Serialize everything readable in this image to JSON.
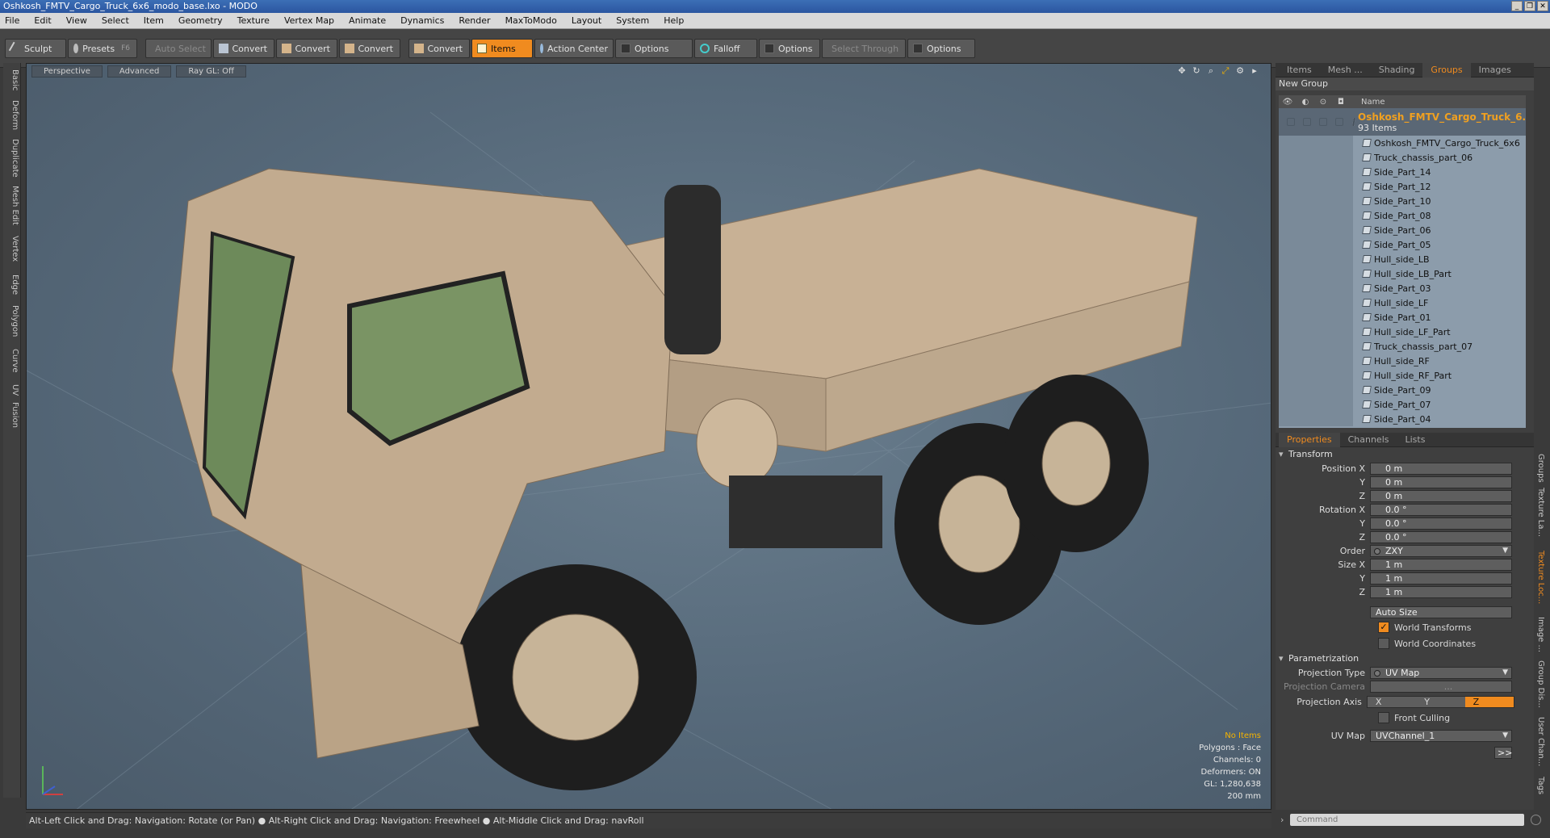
{
  "window": {
    "title": "Oshkosh_FMTV_Cargo_Truck_6x6_modo_base.lxo - MODO"
  },
  "menu": [
    "File",
    "Edit",
    "View",
    "Select",
    "Item",
    "Geometry",
    "Texture",
    "Vertex Map",
    "Animate",
    "Dynamics",
    "Render",
    "MaxToModo",
    "Layout",
    "System",
    "Help"
  ],
  "toolbar": {
    "sculpt": "Sculpt",
    "presets": "Presets",
    "presets_key": "F6",
    "auto_select": "Auto Select",
    "convert1": "Convert",
    "convert2": "Convert",
    "convert3": "Convert",
    "convert4": "Convert",
    "items": "Items",
    "action_center": "Action Center",
    "options1": "Options",
    "falloff": "Falloff",
    "options2": "Options",
    "select_through": "Select Through",
    "options3": "Options"
  },
  "left_tabs": [
    "Basic",
    "Deform",
    "Duplicate",
    "Mesh Edit",
    "Vertex",
    "Edge",
    "Polygon",
    "Curve",
    "UV",
    "Fusion"
  ],
  "viewport": {
    "view": "Perspective",
    "shading": "Advanced",
    "raygl": "Ray GL: Off",
    "stats": {
      "items": "No Items",
      "polygons": "Polygons : Face",
      "channels": "Channels: 0",
      "deformers": "Deformers: ON",
      "gl": "GL: 1,280,638",
      "size": "200 mm"
    }
  },
  "status": "Alt-Left Click and Drag: Navigation: Rotate (or Pan) ● Alt-Right Click and Drag: Navigation: Freewheel ● Alt-Middle Click and Drag: navRoll",
  "panel_tabs": [
    "Items",
    "Mesh ...",
    "Shading",
    "Groups",
    "Images"
  ],
  "new_group": "New Group",
  "tree_header": "Name",
  "group": {
    "name": "Oshkosh_FMTV_Cargo_Truck_6...",
    "count": "93 Items"
  },
  "tree_items": [
    "Oshkosh_FMTV_Cargo_Truck_6x6",
    "Truck_chassis_part_06",
    "Side_Part_14",
    "Side_Part_12",
    "Side_Part_10",
    "Side_Part_08",
    "Side_Part_06",
    "Side_Part_05",
    "Hull_side_LB",
    "Hull_side_LB_Part",
    "Side_Part_03",
    "Hull_side_LF",
    "Side_Part_01",
    "Hull_side_LF_Part",
    "Truck_chassis_part_07",
    "Hull_side_RF",
    "Hull_side_RF_Part",
    "Side_Part_09",
    "Side_Part_07",
    "Side_Part_04"
  ],
  "prop_tabs": [
    "Properties",
    "Channels",
    "Lists"
  ],
  "properties": {
    "transform": "Transform",
    "position_label": "Position X",
    "pos": [
      "0 m",
      "0 m",
      "0 m"
    ],
    "rotation_label": "Rotation X",
    "rot": [
      "0.0 °",
      "0.0 °",
      "0.0 °"
    ],
    "order_label": "Order",
    "order": "ZXY",
    "size_label": "Size X",
    "size": [
      "1 m",
      "1 m",
      "1 m"
    ],
    "y": "Y",
    "z": "Z",
    "auto_size": "Auto Size",
    "world_transforms": "World Transforms",
    "world_coordinates": "World Coordinates",
    "parametrization": "Parametrization",
    "projection_type_label": "Projection Type",
    "projection_type": "UV Map",
    "projection_camera_label": "Projection Camera",
    "projection_camera": "...",
    "projection_axis_label": "Projection Axis",
    "axes": [
      "X",
      "Y",
      "Z"
    ],
    "front_culling": "Front Culling",
    "uvmap_label": "UV Map",
    "uvmap": "UVChannel_1",
    "more": ">>"
  },
  "right_vtabs": [
    "Groups",
    "Texture La...",
    "Texture Loc...",
    "Image ...",
    "Group Dis...",
    "User Chan...",
    "Tags"
  ],
  "command_placeholder": "Command"
}
